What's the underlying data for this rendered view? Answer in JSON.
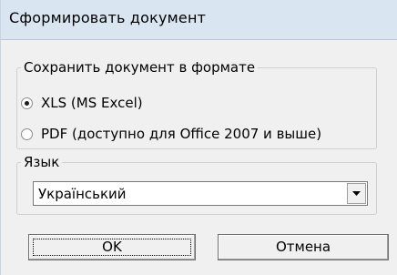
{
  "window": {
    "title": "Сформировать документ"
  },
  "format_group": {
    "legend": "Сохранить документ в формате",
    "options": [
      {
        "label": "XLS (MS Excel)",
        "checked": true
      },
      {
        "label": "PDF (доступно для Office 2007 и выше)",
        "checked": false
      }
    ]
  },
  "language_group": {
    "legend": "Язык",
    "selected": "Український",
    "dropdown_icon": "chevron-down-icon"
  },
  "buttons": {
    "ok": "OK",
    "cancel": "Отмена"
  }
}
